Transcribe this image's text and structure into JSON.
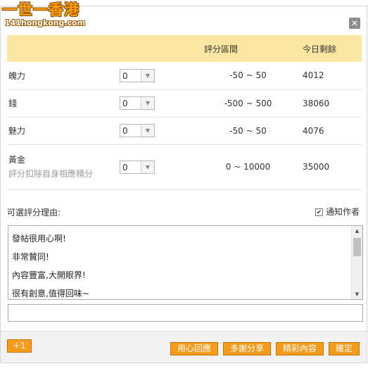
{
  "logo": {
    "main": "一世一香港",
    "sub": "141hongkong.com"
  },
  "header": {
    "col_range": "評分區間",
    "col_remaining": "今日剩餘"
  },
  "rows": [
    {
      "label": "魄力",
      "select_value": "0",
      "range": "-50 ~ 50",
      "remaining": "4012"
    },
    {
      "label": "錢",
      "select_value": "0",
      "range": "-500 ~ 500",
      "remaining": "38060"
    },
    {
      "label": "魅力",
      "select_value": "0",
      "range": "-50 ~ 50",
      "remaining": "4076"
    },
    {
      "label": "黃金",
      "note": "評分扣除自身相應積分",
      "select_value": "0",
      "range": "0 ~ 10000",
      "remaining": "35000"
    }
  ],
  "reason": {
    "label": "可選評分理由:",
    "notify_label": "通知作者",
    "notify_checked": true,
    "items": [
      "發帖很用心啊!",
      "非常贊同!",
      "內容豐富,大開眼界!",
      "很有創意,值得回味~"
    ],
    "input_value": ""
  },
  "buttons": {
    "plus": "+1",
    "quick1": "用心回應",
    "quick2": "多謝分享",
    "quick3": "精彩內容",
    "confirm": "確定"
  },
  "colors": {
    "header_bg": "#fbe7a2",
    "button_bg": "#f49b1c",
    "logo": "#ff9f00"
  }
}
